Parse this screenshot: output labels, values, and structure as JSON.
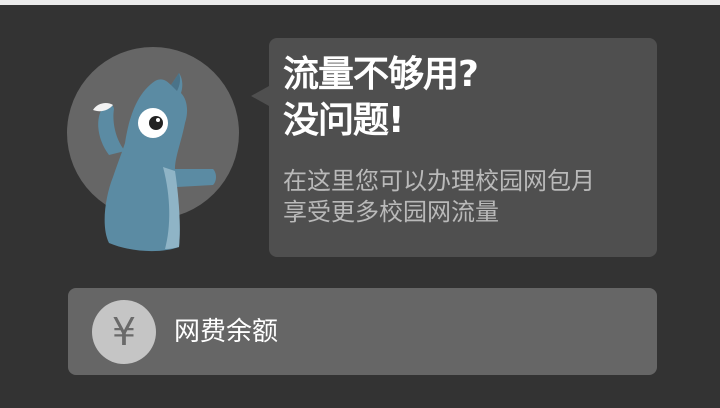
{
  "promo": {
    "headline_line1": "流量不够用?",
    "headline_line2": "没问题!",
    "desc_line1": "在这里您可以办理校园网包月",
    "desc_line2": "享受更多校园网流量"
  },
  "balance_button": {
    "icon": "yen-icon",
    "icon_glyph": "¥",
    "label": "网费余额"
  },
  "colors": {
    "background": "#333333",
    "bubble": "#4f4f4f",
    "button": "#666666",
    "mascot": "#5b8ba3"
  }
}
